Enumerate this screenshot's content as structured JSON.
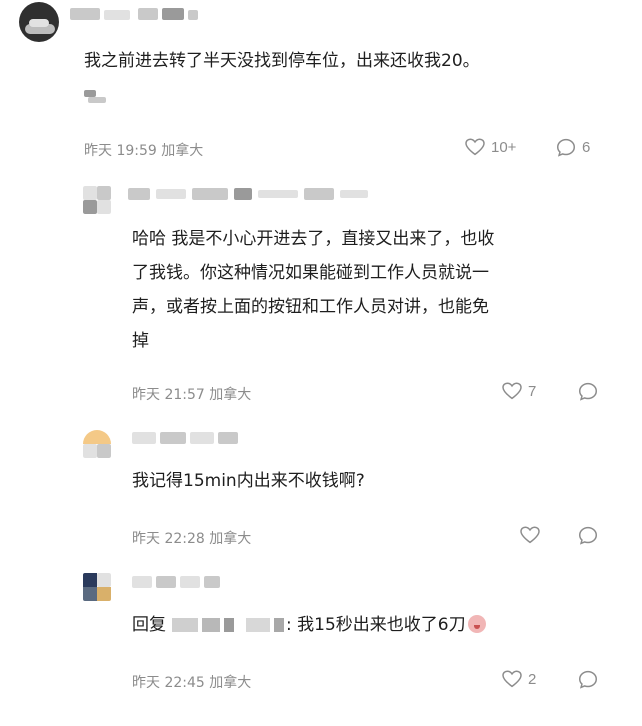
{
  "comments": [
    {
      "text_line1": "我之前进去转了半天没找到停车位，出来还收我20。",
      "time": "昨天 19:59",
      "location": "加拿大",
      "likes": "10+",
      "replies": "6"
    },
    {
      "text_line1": "哈哈 我是不小心开进去了，直接又出来了，也收",
      "text_line2": "了我钱。你这种情况如果能碰到工作人员就说一",
      "text_line3": "声，或者按上面的按钮和工作人员对讲，也能免",
      "text_line4": "掉",
      "time": "昨天 21:57",
      "location": "加拿大",
      "likes": "7"
    },
    {
      "text_line1": "我记得15min内出来不收钱啊?",
      "time": "昨天 22:28",
      "location": "加拿大"
    },
    {
      "reply_prefix": "回复",
      "text_after_mention": ": 我15秒出来也收了6刀",
      "time": "昨天 22:45",
      "location": "加拿大",
      "likes": "2"
    }
  ],
  "icons": {
    "like": "heart-outline-icon",
    "reply": "chat-bubble-icon",
    "reaction": "crying-face-emoji"
  },
  "colors": {
    "text": "#1e1e1e",
    "meta": "#8c8c8c"
  }
}
